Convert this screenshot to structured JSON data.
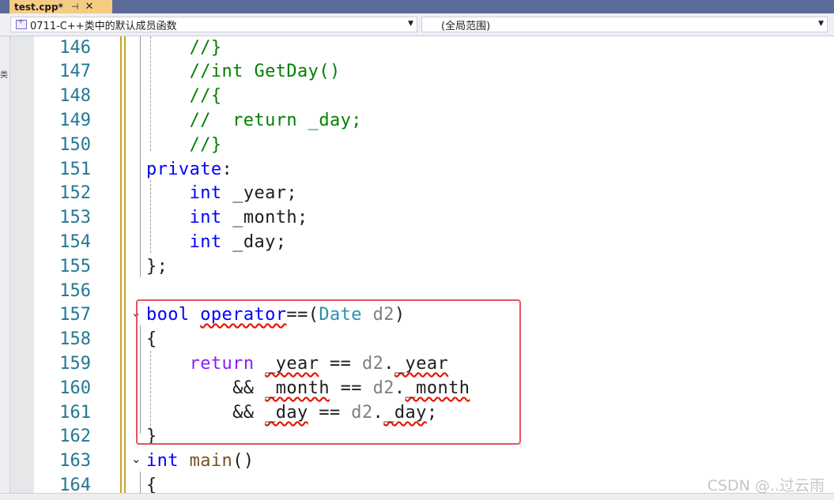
{
  "tab": {
    "name": "test.cpp*",
    "pin": "⊣",
    "close": "✕"
  },
  "nav": {
    "project": "0711-C++类中的默认成员函数",
    "scope": "(全局范围)"
  },
  "lines": [
    {
      "n": "146",
      "text": "    //}"
    },
    {
      "n": "147",
      "text": "    //int GetDay()"
    },
    {
      "n": "148",
      "text": "    //{"
    },
    {
      "n": "149",
      "text": "    //  return _day;"
    },
    {
      "n": "150",
      "text": "    //}"
    },
    {
      "n": "151",
      "text": "private:"
    },
    {
      "n": "152",
      "text": "    int _year;"
    },
    {
      "n": "153",
      "text": "    int _month;"
    },
    {
      "n": "154",
      "text": "    int _day;"
    },
    {
      "n": "155",
      "text": "};"
    },
    {
      "n": "156",
      "text": ""
    },
    {
      "n": "157",
      "text": "bool operator==(Date d2)"
    },
    {
      "n": "158",
      "text": "{"
    },
    {
      "n": "159",
      "text": "    return _year == d2._year"
    },
    {
      "n": "160",
      "text": "        && _month == d2._month"
    },
    {
      "n": "161",
      "text": "        && _day == d2._day;"
    },
    {
      "n": "162",
      "text": "}"
    },
    {
      "n": "163",
      "text": "int main()"
    },
    {
      "n": "164",
      "text": "{"
    }
  ],
  "watermark": "CSDN @..过云雨",
  "colors": {
    "keyword": "#0000ff",
    "comment": "#008000",
    "type": "#2b91af",
    "param": "#808080",
    "highlight_box": "#e5535e"
  }
}
